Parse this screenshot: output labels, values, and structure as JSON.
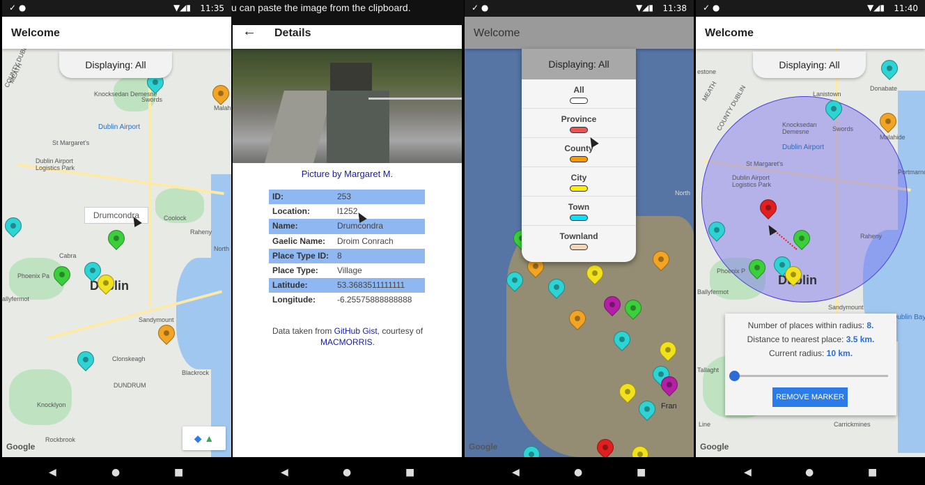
{
  "status": {
    "times": [
      "11:35",
      "11:38",
      "11:40"
    ]
  },
  "clipboard_banner": "u can paste the image from the clipboard.",
  "screen1": {
    "title": "Welcome",
    "displaying": "Displaying: All",
    "tooltip": "Drumcondra",
    "google": "Google",
    "map_labels": [
      "Knocksedan Demesne",
      "Swords",
      "Dublin Airport",
      "St Margaret's",
      "Dublin Airport Logistics Park",
      "Coolock",
      "Raheny",
      "Cabra",
      "Phoenix Pa",
      "Dublin",
      "allyfermot",
      "Sandymount",
      "Clonskeagh",
      "Blackrock",
      "DUNDRUM",
      "Knocklyon",
      "Rockbrook",
      "COUNTY DUBLIN",
      "MEATH",
      "Malah",
      "North"
    ]
  },
  "screen2": {
    "title": "Details",
    "credit": "Picture by Margaret M.",
    "rows": [
      {
        "k": "ID:",
        "v": "253"
      },
      {
        "k": "Location:",
        "v": "l1252"
      },
      {
        "k": "Name:",
        "v": "Drumcondra"
      },
      {
        "k": "Gaelic Name:",
        "v": "Droim Conrach"
      },
      {
        "k": "Place Type ID:",
        "v": "8"
      },
      {
        "k": "Place Type:",
        "v": "Village"
      },
      {
        "k": "Latitude:",
        "v": "53.3683511111111"
      },
      {
        "k": "Longitude:",
        "v": "-6.25575888888888"
      }
    ],
    "footer_pre": "Data taken from ",
    "footer_link1": "GitHub Gist",
    "footer_mid": ", courtesy of",
    "footer_link2": "MACMORRIS",
    "footer_end": "."
  },
  "screen3": {
    "title": "Welcome",
    "displaying": "Displaying: All",
    "google": "Google",
    "options": [
      {
        "label": "All",
        "color": "#ffffff"
      },
      {
        "label": "Province",
        "color": "#ef5350"
      },
      {
        "label": "County",
        "color": "#ff9800"
      },
      {
        "label": "City",
        "color": "#ffee00"
      },
      {
        "label": "Town",
        "color": "#00e5ff"
      },
      {
        "label": "Townland",
        "color": "#f5d5b5"
      }
    ],
    "map_labels": [
      "North",
      "Fran"
    ]
  },
  "screen4": {
    "title": "Welcome",
    "displaying": "Displaying: All",
    "google": "Google",
    "panel": {
      "line1_pre": "Number of places within radius: ",
      "line1_val": "8.",
      "line2_pre": "Distance to nearest place: ",
      "line2_val": "3.5 km.",
      "line3_pre": "Current radius: ",
      "line3_val": "10 km.",
      "button": "REMOVE MARKER",
      "slider_fraction": 0.0
    },
    "map_labels": [
      "Donabate",
      "Lanistown",
      "Malahide",
      "Portmarnock",
      "Swords",
      "Knocksedan Demesne",
      "Dublin Airport",
      "St Margaret's",
      "Dublin Airport Logistics Park",
      "Raheny",
      "Phoenix P",
      "Dublin",
      "Ballyfermot",
      "Sandymount",
      "Tallaght",
      "Carrickmines",
      "Line",
      "Dublin Bay",
      "COUNTY DUBLIN",
      "MEATH",
      "estone"
    ]
  },
  "nav": {
    "back": "◀",
    "home": "●",
    "recents": "■"
  }
}
